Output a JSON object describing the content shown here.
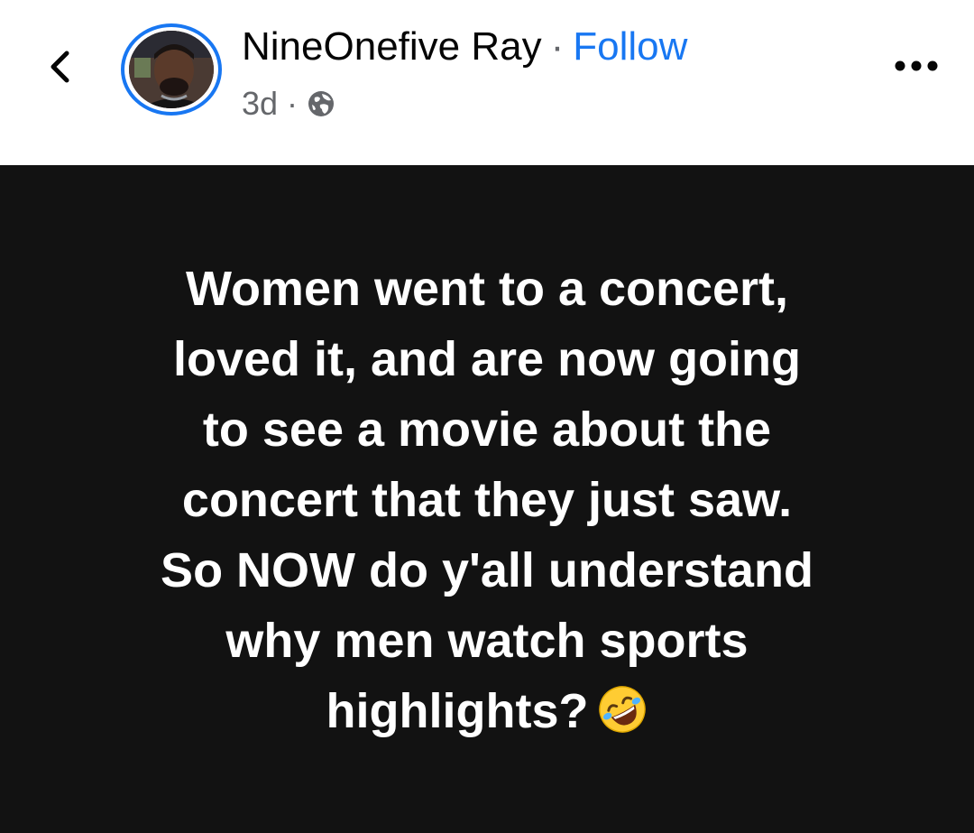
{
  "header": {
    "back_icon": "chevron-left-icon",
    "author_name": "NineOnefive Ray",
    "separator": "·",
    "follow_label": "Follow",
    "time": "3d",
    "meta_separator": "·",
    "privacy_icon": "globe-icon",
    "more_icon": "more-options-icon",
    "accent_color": "#1877f2"
  },
  "post": {
    "background_color": "#121212",
    "text_color": "#ffffff",
    "lines": [
      "Women went to a concert,",
      "loved it, and are now going",
      "to see a movie about the",
      "concert that they just saw.",
      "So NOW do y'all understand",
      "why men watch sports",
      "highlights?"
    ],
    "emoji": "rolling-on-floor-laughing-emoji"
  }
}
